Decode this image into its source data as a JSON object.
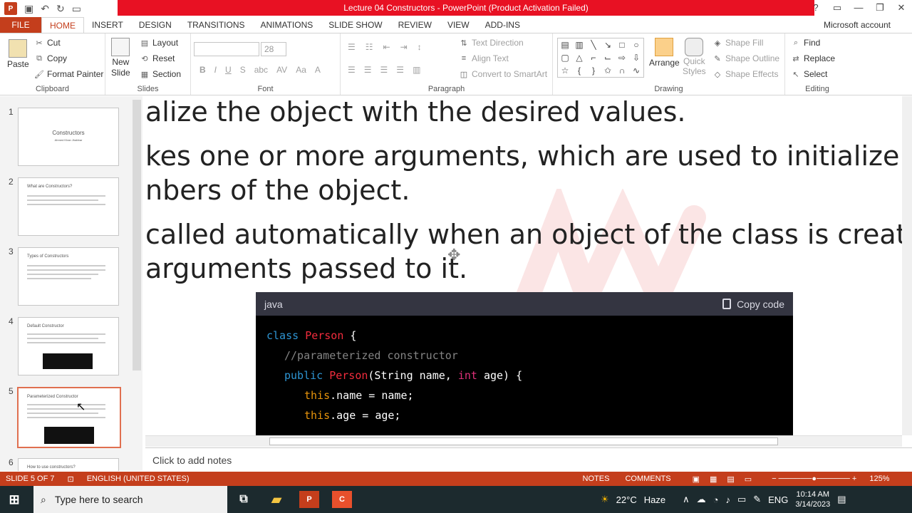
{
  "window": {
    "title": "Lecture 04 Constructors - PowerPoint (Product Activation Failed)",
    "controls": [
      "?",
      "▭",
      "—",
      "❐",
      "✕"
    ]
  },
  "tabs": [
    {
      "label": "FILE"
    },
    {
      "label": "HOME"
    },
    {
      "label": "INSERT"
    },
    {
      "label": "DESIGN"
    },
    {
      "label": "TRANSITIONS"
    },
    {
      "label": "ANIMATIONS"
    },
    {
      "label": "SLIDE SHOW"
    },
    {
      "label": "REVIEW"
    },
    {
      "label": "VIEW"
    },
    {
      "label": "ADD-INS"
    }
  ],
  "account": "Microsoft account",
  "ribbon": {
    "clipboard": {
      "label": "Clipboard",
      "paste": "Paste",
      "cut": "Cut",
      "copy": "Copy",
      "format_painter": "Format Painter"
    },
    "slides": {
      "label": "Slides",
      "new_slide": "New",
      "new_slide2": "Slide",
      "layout": "Layout",
      "reset": "Reset",
      "section": "Section"
    },
    "font": {
      "label": "Font",
      "size": "28",
      "bold": "B",
      "italic": "I",
      "underline": "U",
      "strike": "S",
      "shadow": "abc",
      "spacing": "AV",
      "case": "Aa",
      "color": "A"
    },
    "paragraph": {
      "label": "Paragraph",
      "text_direction": "Text Direction",
      "align_text": "Align Text",
      "convert_smartart": "Convert to SmartArt"
    },
    "drawing": {
      "label": "Drawing",
      "arrange": "Arrange",
      "quick_styles": "Quick",
      "quick_styles2": "Styles",
      "shape_fill": "Shape Fill",
      "shape_outline": "Shape Outline",
      "shape_effects": "Shape Effects"
    },
    "editing": {
      "label": "Editing",
      "find": "Find",
      "replace": "Replace",
      "select": "Select"
    }
  },
  "slides": [
    {
      "num": "1",
      "title": "Constructors",
      "subtitle": "Ahmed Khan Jhabbar"
    },
    {
      "num": "2",
      "title": "What are Constructors?"
    },
    {
      "num": "3",
      "title": "Types of Constructors"
    },
    {
      "num": "4",
      "title": "Default Constructor"
    },
    {
      "num": "5",
      "title": "Parameterized Constructor"
    },
    {
      "num": "6",
      "title": "How to use constructors?"
    }
  ],
  "slide": {
    "line1": "alize the object with the desired values.",
    "line2": "kes one or more arguments, which are used to initialize the d",
    "line3": "nbers of the object.",
    "line4": "called automatically when an object of the class is created w",
    "line5": "arguments passed to it."
  },
  "code": {
    "lang": "java",
    "copy": "Copy code",
    "l1_kw": "class",
    "l1_cls": "Person",
    "l1_end": " {",
    "l2": "//parameterized constructor",
    "l3_kw": "public",
    "l3_cls": "Person",
    "l3_a": "(String name, ",
    "l3_int": "int",
    "l3_b": " age) {",
    "l4_this": "this",
    "l4_rest": ".name = name;",
    "l5_this": "this",
    "l5_rest": ".age = age;"
  },
  "notes_placeholder": "Click to add notes",
  "status": {
    "slide": "SLIDE 5 OF 7",
    "language": "ENGLISH (UNITED STATES)",
    "notes": "NOTES",
    "comments": "COMMENTS",
    "zoom": "125%"
  },
  "taskbar": {
    "search": "Type here to search",
    "weather": "22°C",
    "weather_desc": "Haze",
    "lang": "ENG",
    "time": "10:14 AM",
    "date": "3/14/2023"
  },
  "colors": {
    "accent": "#c43e1c",
    "title_alert": "#e81123",
    "code_bg": "#000000"
  }
}
